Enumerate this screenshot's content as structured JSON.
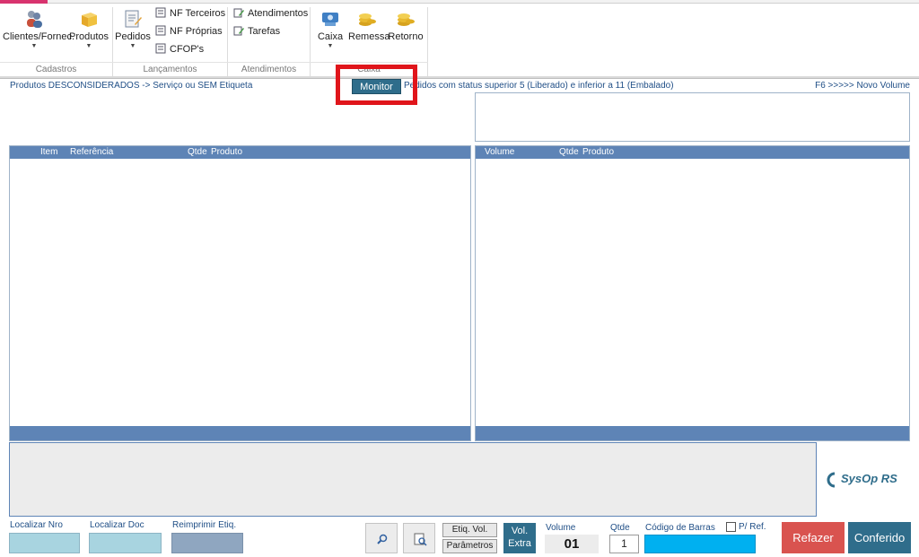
{
  "ribbon": {
    "cadastros": {
      "clientes": "Clientes/Fornec.",
      "produtos": "Produtos",
      "group_label": "Cadastros"
    },
    "lancamentos": {
      "pedidos": "Pedidos",
      "nf_terceiros": "NF Terceiros",
      "nf_proprias": "NF Próprias",
      "cfops": "CFOP's",
      "group_label": "Lançamentos"
    },
    "atendimentos": {
      "atendimentos": "Atendimentos",
      "tarefas": "Tarefas",
      "group_label": "Atendimentos"
    },
    "caixa": {
      "caixa": "Caixa",
      "remessa": "Remessa",
      "retorno": "Retorno",
      "group_label": "Caixa"
    }
  },
  "info": {
    "left": "Produtos DESCONSIDERADOS -> Serviço ou SEM Etiqueta",
    "monitor": "Monitor",
    "middle": "Pedidos com status superior 5 (Liberado) e inferior a 11 (Embalado)",
    "right": "F6  >>>>> Novo Volume"
  },
  "left_grid": {
    "columns": [
      "Item",
      "Referência",
      "Qtde",
      "Produto"
    ]
  },
  "right_grid": {
    "columns": [
      "Volume",
      "Qtde",
      "Produto"
    ]
  },
  "logo": {
    "text": "SysOp RS"
  },
  "bottom": {
    "localizar_nro": "Localizar Nro",
    "localizar_doc": "Localizar Doc",
    "reimprimir": "Reimprimir Etiq.",
    "etiq_vol": "Etiq. Vol.",
    "parametros": "Parâmetros",
    "vol_extra_1": "Vol.",
    "vol_extra_2": "Extra",
    "volume_label": "Volume",
    "volume_value": "01",
    "qtde_label": "Qtde",
    "qtde_value": "1",
    "codigo_label": "Código de Barras",
    "pref_label": "P/ Ref.",
    "refazer": "Refazer",
    "conferido": "Conferido"
  },
  "colors": {
    "accent_blue": "#5e84b6",
    "highlight_red": "#e0151b",
    "refazer": "#d9534f",
    "conferido": "#2f6d8b"
  }
}
